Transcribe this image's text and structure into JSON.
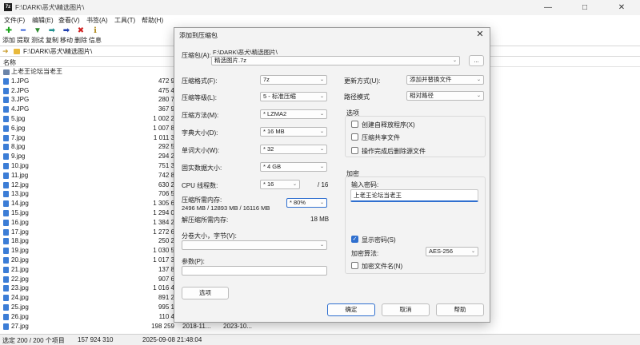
{
  "window": {
    "title": "F:\\DARK\\恶犬\\精选图片\\",
    "app_icon": "7z"
  },
  "menu": [
    "文件(F)",
    "编辑(E)",
    "查看(V)",
    "书签(A)",
    "工具(T)",
    "帮助(H)"
  ],
  "toolbar": [
    {
      "label": "添加",
      "icon": "plus-icon",
      "glyph": "✚",
      "color": "#1aa31a"
    },
    {
      "label": "提取",
      "icon": "minus-icon",
      "glyph": "━",
      "color": "#1f4fd6"
    },
    {
      "label": "测试",
      "icon": "check-icon",
      "glyph": "▼",
      "color": "#2d8a2d"
    },
    {
      "label": "复制",
      "icon": "copy-arrow-icon",
      "glyph": "➡",
      "color": "#1f8f8f"
    },
    {
      "label": "移动",
      "icon": "move-arrow-icon",
      "glyph": "➡",
      "color": "#1f3fb0"
    },
    {
      "label": "删除",
      "icon": "delete-x-icon",
      "glyph": "✖",
      "color": "#d01f1f"
    },
    {
      "label": "信息",
      "icon": "info-icon",
      "glyph": "ℹ",
      "color": "#b08a1a"
    }
  ],
  "address": "F:\\DARK\\恶犬\\精选图片\\",
  "columns": {
    "name": "名称"
  },
  "files": [
    {
      "name": "上老王论坛当老王",
      "size": "",
      "folder": true
    },
    {
      "name": "1.JPG",
      "size": "472 9"
    },
    {
      "name": "2.JPG",
      "size": "475 4"
    },
    {
      "name": "3.JPG",
      "size": "280 7"
    },
    {
      "name": "4.JPG",
      "size": "367 9"
    },
    {
      "name": "5.jpg",
      "size": "1 002 2"
    },
    {
      "name": "6.jpg",
      "size": "1 007 8"
    },
    {
      "name": "7.jpg",
      "size": "1 011 3"
    },
    {
      "name": "8.jpg",
      "size": "292 5"
    },
    {
      "name": "9.jpg",
      "size": "294 2"
    },
    {
      "name": "10.jpg",
      "size": "751 3"
    },
    {
      "name": "11.jpg",
      "size": "742 8"
    },
    {
      "name": "12.jpg",
      "size": "630 2"
    },
    {
      "name": "13.jpg",
      "size": "706 5"
    },
    {
      "name": "14.jpg",
      "size": "1 305 6"
    },
    {
      "name": "15.jpg",
      "size": "1 294 0"
    },
    {
      "name": "16.jpg",
      "size": "1 384 2"
    },
    {
      "name": "17.jpg",
      "size": "1 272 6"
    },
    {
      "name": "18.jpg",
      "size": "250 2"
    },
    {
      "name": "19.jpg",
      "size": "1 030 5"
    },
    {
      "name": "20.jpg",
      "size": "1 017 3"
    },
    {
      "name": "21.jpg",
      "size": "137 8"
    },
    {
      "name": "22.jpg",
      "size": "907 6"
    },
    {
      "name": "23.jpg",
      "size": "1 016 4"
    },
    {
      "name": "24.jpg",
      "size": "891 2"
    },
    {
      "name": "25.jpg",
      "size": "995 1"
    },
    {
      "name": "26.jpg",
      "size": "110 4"
    },
    {
      "name": "27.jpg",
      "size": "198 259",
      "modified": "2018-11...",
      "created": "2023-10..."
    }
  ],
  "status": {
    "selected": "选定 200 / 200 个项目",
    "total_size": "157 924 310",
    "datetime": "2025-09-08 21:48:04"
  },
  "dialog": {
    "title": "添加到压缩包",
    "archive_label": "压缩包(A):",
    "archive_path": "F:\\DARK\\恶犬\\精选图片\\",
    "archive_name": "精选图片.7z",
    "browse_label": "...",
    "format_label": "压缩格式(F):",
    "format_value": "7z",
    "level_label": "压缩等级(L):",
    "level_value": "5 - 标准压缩",
    "method_label": "压缩方法(M):",
    "method_value": "* LZMA2",
    "dict_label": "字典大小(D):",
    "dict_value": "* 16 MB",
    "word_label": "单词大小(W):",
    "word_value": "* 32",
    "solid_label": "固实数据大小:",
    "solid_value": "* 4 GB",
    "threads_label": "CPU 线程数:",
    "threads_value": "* 16",
    "threads_max": "/ 16",
    "mem_label": "压缩所需内存:",
    "mem_detail": "2496 MB / 12893 MB / 16116 MB",
    "mem_value": "* 80%",
    "decomp_label": "解压缩所需内存:",
    "decomp_value": "18 MB",
    "split_label": "分卷大小，字节(V):",
    "params_label": "参数(P):",
    "options_button": "选项",
    "update_label": "更新方式(U):",
    "update_value": "添加并替换文件",
    "pathmode_label": "路径模式",
    "pathmode_value": "相对路径",
    "options_group": "选项",
    "opt_sfx": "创建自释放程序(X)",
    "opt_shared": "压缩共享文件",
    "opt_delete": "操作完成后删除源文件",
    "encrypt_group": "加密",
    "pwd_label": "输入密码:",
    "pwd_value": "上老王论坛当老王",
    "show_pwd": "显示密码(S)",
    "enc_method_label": "加密算法:",
    "enc_method_value": "AES-256",
    "enc_names": "加密文件名(N)",
    "ok": "确定",
    "cancel": "取消",
    "help": "帮助"
  }
}
